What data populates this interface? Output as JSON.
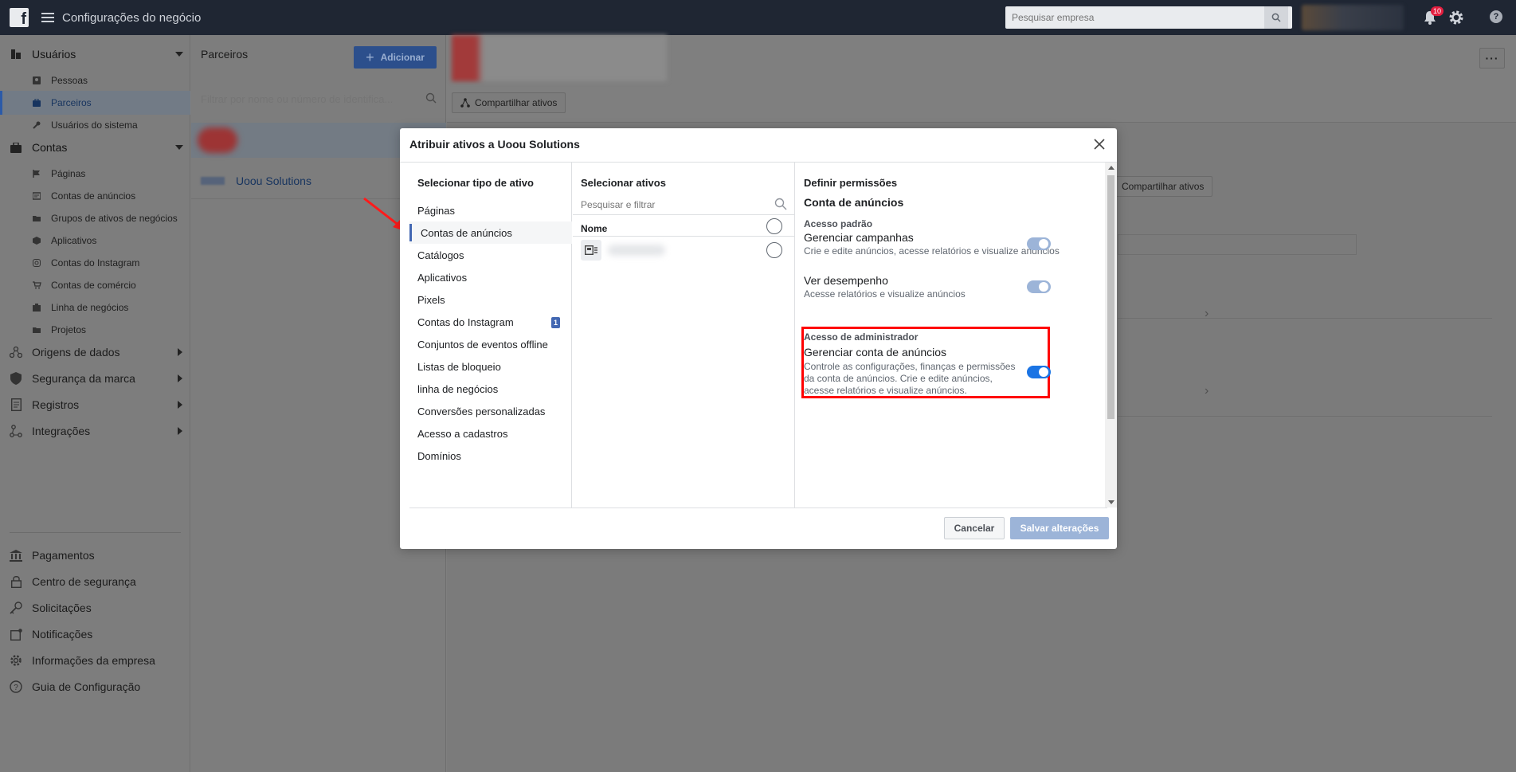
{
  "topbar": {
    "title": "Configurações do negócio",
    "search_placeholder": "Pesquisar empresa",
    "notifications_count": "10"
  },
  "sidebar": {
    "usuarios": {
      "label": "Usuários",
      "items": [
        {
          "label": "Pessoas"
        },
        {
          "label": "Parceiros"
        },
        {
          "label": "Usuários do sistema"
        }
      ]
    },
    "contas": {
      "label": "Contas",
      "items": [
        {
          "label": "Páginas"
        },
        {
          "label": "Contas de anúncios"
        },
        {
          "label": "Grupos de ativos de negócios"
        },
        {
          "label": "Aplicativos"
        },
        {
          "label": "Contas do Instagram"
        },
        {
          "label": "Contas de comércio"
        },
        {
          "label": "Linha de negócios"
        },
        {
          "label": "Projetos"
        }
      ]
    },
    "groups": [
      {
        "label": "Origens de dados"
      },
      {
        "label": "Segurança da marca"
      },
      {
        "label": "Registros"
      },
      {
        "label": "Integrações"
      }
    ],
    "bottom": [
      {
        "label": "Pagamentos"
      },
      {
        "label": "Centro de segurança"
      },
      {
        "label": "Solicitações"
      },
      {
        "label": "Notificações"
      },
      {
        "label": "Informações da empresa"
      },
      {
        "label": "Guia de Configuração"
      }
    ]
  },
  "partners": {
    "title": "Parceiros",
    "add_label": "Adicionar",
    "filter_placeholder": "Filtrar por nome ou número de identifica...",
    "partner_name": "Uoou Solutions"
  },
  "main": {
    "share_label": "Compartilhar ativos"
  },
  "modal": {
    "title": "Atribuir ativos a Uoou Solutions",
    "col1_title": "Selecionar tipo de ativo",
    "asset_types": [
      {
        "label": "Páginas"
      },
      {
        "label": "Contas de anúncios"
      },
      {
        "label": "Catálogos"
      },
      {
        "label": "Aplicativos"
      },
      {
        "label": "Pixels"
      },
      {
        "label": "Contas do Instagram",
        "badge": "1"
      },
      {
        "label": "Conjuntos de eventos offline"
      },
      {
        "label": "Listas de bloqueio"
      },
      {
        "label": "linha de negócios"
      },
      {
        "label": "Conversões personalizadas"
      },
      {
        "label": "Acesso a cadastros"
      },
      {
        "label": "Domínios"
      }
    ],
    "selected_type": "Contas de anúncios",
    "col2_title": "Selecionar ativos",
    "search_placeholder": "Pesquisar e filtrar",
    "name_header": "Nome",
    "col3_title": "Definir permissões",
    "permission_heading": "Conta de anúncios",
    "standard_group": "Acesso padrão",
    "perm1_name": "Gerenciar campanhas",
    "perm1_desc": "Crie e edite anúncios, acesse relatórios e visualize anúncios",
    "perm2_name": "Ver desempenho",
    "perm2_desc": "Acesse relatórios e visualize anúncios",
    "admin_group": "Acesso de administrador",
    "perm3_name": "Gerenciar conta de anúncios",
    "perm3_desc": "Controle as configurações, finanças e permissões da conta de anúncios. Crie e edite anúncios, acesse relatórios e visualize anúncios.",
    "cancel_label": "Cancelar",
    "save_label": "Salvar alterações"
  },
  "colors": {
    "topbar": "#1f2633",
    "fb_blue": "#4267b2",
    "toggle_on": "#1b74e4",
    "highlight": "#ff0000"
  }
}
